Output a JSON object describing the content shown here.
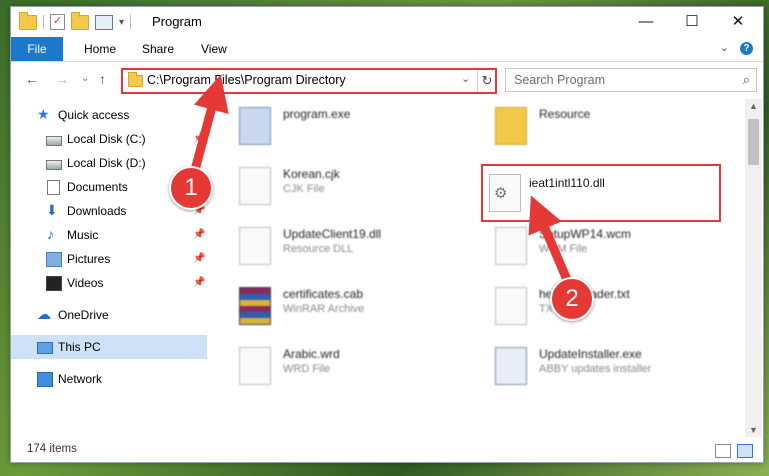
{
  "window": {
    "title": "Program"
  },
  "ribbon": {
    "tabs": [
      "File",
      "Home",
      "Share",
      "View"
    ]
  },
  "address": {
    "path": "C:\\Program Files\\Program Directory"
  },
  "search": {
    "placeholder": "Search Program"
  },
  "nav": {
    "items": [
      "Quick access",
      "Local Disk (C:)",
      "Local Disk (D:)",
      "Documents",
      "Downloads",
      "Music",
      "Pictures",
      "Videos",
      "OneDrive",
      "This PC",
      "Network"
    ]
  },
  "files": [
    {
      "name": "program.exe",
      "type": ""
    },
    {
      "name": "Resource",
      "type": ""
    },
    {
      "name": "Korean.cjk",
      "type": "CJK File"
    },
    {
      "name": "ieat1intl110.dll",
      "type": ""
    },
    {
      "name": "UpdateClient19.dll",
      "type": "Resource DLL"
    },
    {
      "name": "SetupWP14.wcm",
      "type": "WCM File"
    },
    {
      "name": "certificates.cab",
      "type": "WinRAR Archive"
    },
    {
      "name": "helpfileLoader.txt",
      "type": "TXT File"
    },
    {
      "name": "Arabic.wrd",
      "type": "WRD File"
    },
    {
      "name": "UpdateInstaller.exe",
      "type": "ABBY updates installer"
    }
  ],
  "status": {
    "count": "174 items"
  },
  "annotations": {
    "step1": "1",
    "step2": "2"
  },
  "colors": {
    "accent": "#1979ca",
    "highlight": "#e53935",
    "selection": "#cde1f7"
  }
}
